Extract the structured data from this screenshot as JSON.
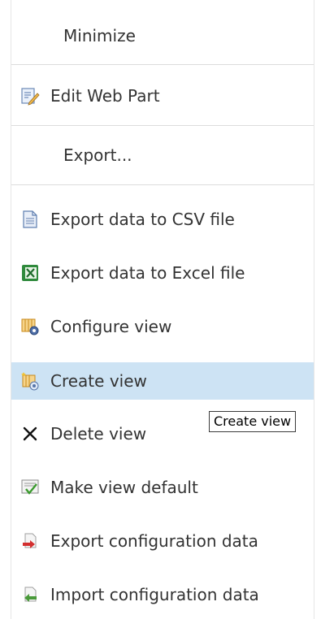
{
  "menu": {
    "items": [
      {
        "label": "Minimize",
        "icon": ""
      },
      {
        "label": "Edit Web Part",
        "icon": "edit-document-icon"
      },
      {
        "label": "Export...",
        "icon": ""
      },
      {
        "label": "Export data to CSV file",
        "icon": "text-document-icon"
      },
      {
        "label": "Export data to Excel file",
        "icon": "excel-icon"
      },
      {
        "label": "Configure view",
        "icon": "configure-view-icon"
      },
      {
        "label": "Create view",
        "icon": "create-view-icon"
      },
      {
        "label": "Delete view",
        "icon": "delete-x-icon"
      },
      {
        "label": "Make view default",
        "icon": "checklist-icon"
      },
      {
        "label": "Export configuration data",
        "icon": "export-arrow-icon"
      },
      {
        "label": "Import configuration data",
        "icon": "import-arrow-icon"
      }
    ],
    "selected_index": 6
  },
  "tooltip": {
    "text": "Create view"
  },
  "colors": {
    "highlight": "#cde3f4",
    "separator": "#dcdcdc",
    "text": "#333333"
  }
}
